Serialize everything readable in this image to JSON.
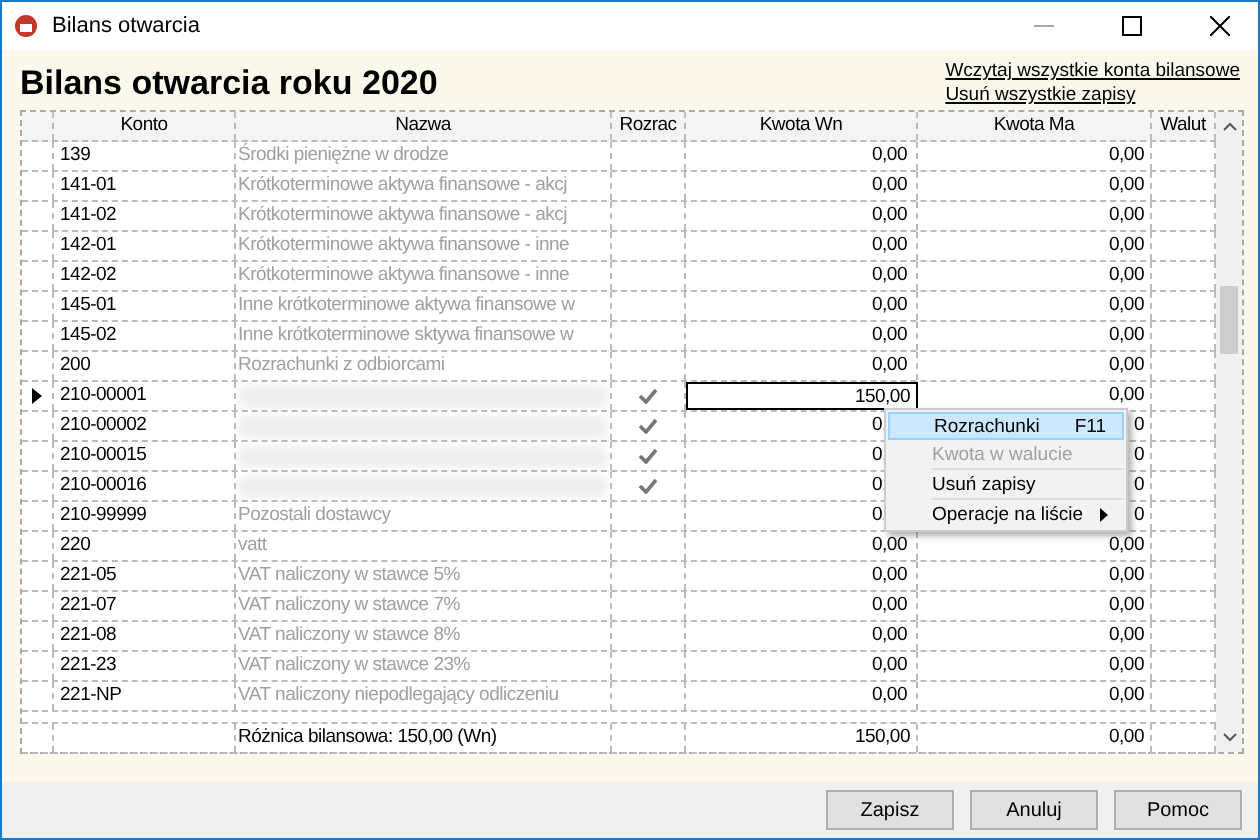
{
  "window": {
    "title": "Bilans otwarcia"
  },
  "heading": "Bilans otwarcia roku 2020",
  "links": [
    "Wczytaj wszystkie konta bilansowe",
    "Usuń wszystkie zapisy"
  ],
  "table": {
    "columns": [
      "Konto",
      "Nazwa",
      "Rozrac",
      "Kwota Wn",
      "Kwota Ma",
      "Walut"
    ],
    "rows": [
      {
        "konto": "139",
        "nazwa": "Środki pieniężne w drodze",
        "rozrac": false,
        "wn": "0,00",
        "ma": "0,00",
        "current": false
      },
      {
        "konto": "141-01",
        "nazwa": "Krótkoterminowe aktywa finansowe - akcj",
        "rozrac": false,
        "wn": "0,00",
        "ma": "0,00",
        "current": false
      },
      {
        "konto": "141-02",
        "nazwa": "Krótkoterminowe aktywa finansowe - akcj",
        "rozrac": false,
        "wn": "0,00",
        "ma": "0,00",
        "current": false
      },
      {
        "konto": "142-01",
        "nazwa": "Krótkoterminowe aktywa finansowe - inne",
        "rozrac": false,
        "wn": "0,00",
        "ma": "0,00",
        "current": false
      },
      {
        "konto": "142-02",
        "nazwa": "Krótkoterminowe aktywa finansowe - inne",
        "rozrac": false,
        "wn": "0,00",
        "ma": "0,00",
        "current": false
      },
      {
        "konto": "145-01",
        "nazwa": "Inne krótkoterminowe aktywa finansowe w",
        "rozrac": false,
        "wn": "0,00",
        "ma": "0,00",
        "current": false
      },
      {
        "konto": "145-02",
        "nazwa": "Inne krótkoterminowe sktywa finansowe w",
        "rozrac": false,
        "wn": "0,00",
        "ma": "0,00",
        "current": false
      },
      {
        "konto": "200",
        "nazwa": "Rozrachunki z odbiorcami",
        "rozrac": false,
        "wn": "0,00",
        "ma": "0,00",
        "current": false
      },
      {
        "konto": "210-00001",
        "blurred": true,
        "rozrac": true,
        "wn": "150,00",
        "ma": "0,00",
        "current": true,
        "focused": true
      },
      {
        "konto": "210-00002",
        "blurred": true,
        "rozrac": true,
        "wn": "0,",
        "ma": "0",
        "current": false
      },
      {
        "konto": "210-00015",
        "blurred": true,
        "rozrac": true,
        "wn": "0,",
        "ma": "0",
        "current": false
      },
      {
        "konto": "210-00016",
        "blurred": true,
        "rozrac": true,
        "wn": "0,",
        "ma": "0",
        "current": false
      },
      {
        "konto": "210-99999",
        "nazwa": "Pozostali dostawcy",
        "rozrac": false,
        "wn": "0,",
        "ma": "0",
        "current": false
      },
      {
        "konto": "220",
        "nazwa": "vatt",
        "rozrac": false,
        "wn": "0,00",
        "ma": "0,00",
        "current": false
      },
      {
        "konto": "221-05",
        "nazwa": "VAT naliczony w stawce 5%",
        "rozrac": false,
        "wn": "0,00",
        "ma": "0,00",
        "current": false
      },
      {
        "konto": "221-07",
        "nazwa": "VAT naliczony w stawce 7%",
        "rozrac": false,
        "wn": "0,00",
        "ma": "0,00",
        "current": false
      },
      {
        "konto": "221-08",
        "nazwa": "VAT naliczony w stawce 8%",
        "rozrac": false,
        "wn": "0,00",
        "ma": "0,00",
        "current": false
      },
      {
        "konto": "221-23",
        "nazwa": "VAT naliczony w stawce 23%",
        "rozrac": false,
        "wn": "0,00",
        "ma": "0,00",
        "current": false
      },
      {
        "konto": "221-NP",
        "nazwa": "VAT naliczony niepodlegający odliczeniu",
        "rozrac": false,
        "wn": "0,00",
        "ma": "0,00",
        "current": false
      }
    ],
    "footer": {
      "nazwa": "Różnica bilansowa: 150,00 (Wn)",
      "wn": "150,00",
      "ma": "0,00"
    }
  },
  "context_menu": [
    {
      "kind": "item",
      "label": "Rozrachunki",
      "shortcut": "F11",
      "selected": true,
      "disabled": false
    },
    {
      "kind": "item",
      "label": "Kwota w walucie",
      "selected": false,
      "disabled": true
    },
    {
      "kind": "separator"
    },
    {
      "kind": "item",
      "label": "Usuń zapisy",
      "selected": false,
      "disabled": false
    },
    {
      "kind": "separator"
    },
    {
      "kind": "submenu",
      "label": "Operacje na liście",
      "selected": false,
      "disabled": false
    }
  ],
  "buttons": [
    "Zapisz",
    "Anuluj",
    "Pomoc"
  ]
}
